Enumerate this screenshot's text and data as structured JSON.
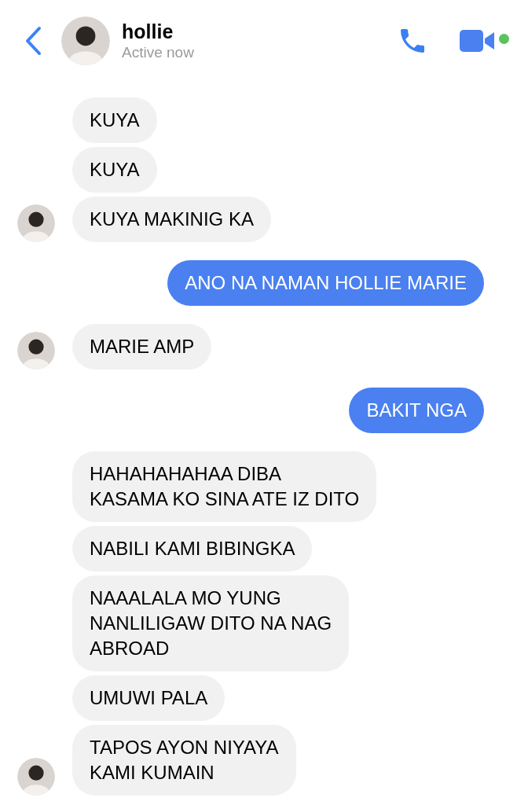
{
  "header": {
    "name": "hollie",
    "status": "Active now",
    "online": true
  },
  "messages": [
    {
      "kind": "received",
      "lines": [
        "KUYA"
      ],
      "avatar": false
    },
    {
      "kind": "received",
      "lines": [
        "KUYA"
      ],
      "avatar": false
    },
    {
      "kind": "received",
      "lines": [
        "KUYA MAKINIG KA"
      ],
      "avatar": true
    },
    {
      "kind": "sent",
      "lines": [
        "ANO NA NAMAN HOLLIE MARIE"
      ]
    },
    {
      "kind": "received",
      "lines": [
        "MARIE AMP"
      ],
      "avatar": true
    },
    {
      "kind": "sent",
      "lines": [
        "BAKIT NGA"
      ]
    },
    {
      "kind": "received",
      "lines": [
        "HAHAHAHAHAA DIBA",
        "KASAMA KO SINA ATE IZ DITO"
      ],
      "avatar": false
    },
    {
      "kind": "received",
      "lines": [
        "NABILI KAMI BIBINGKA"
      ],
      "avatar": false
    },
    {
      "kind": "received",
      "lines": [
        "NAAALALA MO YUNG",
        "NANLILIGAW DITO NA NAG",
        "ABROAD"
      ],
      "avatar": false
    },
    {
      "kind": "received",
      "lines": [
        "UMUWI PALA"
      ],
      "avatar": false
    },
    {
      "kind": "received",
      "lines": [
        "TAPOS AYON NIYAYA",
        "KAMI KUMAIN"
      ],
      "avatar": true
    }
  ]
}
